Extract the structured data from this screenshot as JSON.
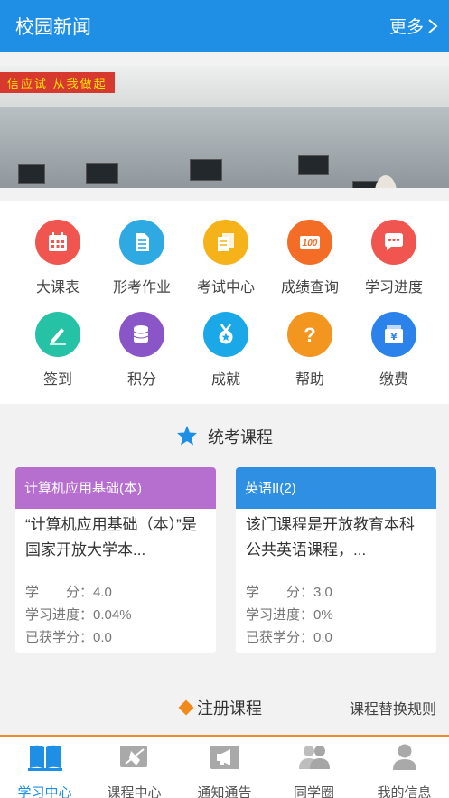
{
  "header": {
    "title": "校园新闻",
    "more_label": "更多"
  },
  "banner": {
    "slogan": "信应试  从我做起"
  },
  "grid": {
    "items": [
      {
        "label": "大课表",
        "icon": "calendar-icon",
        "color": "#f0554f"
      },
      {
        "label": "形考作业",
        "icon": "document-icon",
        "color": "#2ea9e2"
      },
      {
        "label": "考试中心",
        "icon": "copy-icon",
        "color": "#f5b319"
      },
      {
        "label": "成绩查询",
        "icon": "score-100-icon",
        "color": "#f36d26"
      },
      {
        "label": "学习进度",
        "icon": "chat-bubble-icon",
        "color": "#f0554f"
      },
      {
        "label": "签到",
        "icon": "pencil-icon",
        "color": "#25c2a6"
      },
      {
        "label": "积分",
        "icon": "coins-icon",
        "color": "#8a55c7"
      },
      {
        "label": "成就",
        "icon": "medal-icon",
        "color": "#1aa8e8"
      },
      {
        "label": "帮助",
        "icon": "question-icon",
        "color": "#f3961f"
      },
      {
        "label": "缴费",
        "icon": "wallet-yen-icon",
        "color": "#2b82ea"
      }
    ]
  },
  "exam_courses": {
    "title": "统考课程",
    "cards": [
      {
        "band_label": "计算机应用基础(本)",
        "band_color": "#b66fcf",
        "desc": "“计算机应用基础（本）”是国家开放大学本...",
        "credit": "学　　分：4.0",
        "progress": "学习进度：0.04%",
        "earned": "已获学分：0.0"
      },
      {
        "band_label": "英语II(2)",
        "band_color": "#2f8fe2",
        "desc": "该门课程是开放教育本科公共英语课程，...",
        "credit": "学　　分：3.0",
        "progress": "学习进度：0%",
        "earned": "已获学分：0.0"
      }
    ]
  },
  "registered": {
    "title": "注册课程",
    "rules_link": "课程替换规则"
  },
  "tabbar": {
    "tabs": [
      {
        "label": "学习中心",
        "icon": "book-icon",
        "active": true
      },
      {
        "label": "课程中心",
        "icon": "course-icon",
        "active": false
      },
      {
        "label": "通知通告",
        "icon": "megaphone-icon",
        "active": false
      },
      {
        "label": "同学圈",
        "icon": "classmates-icon",
        "active": false
      },
      {
        "label": "我的信息",
        "icon": "user-icon",
        "active": false
      }
    ]
  },
  "colors": {
    "primary": "#1f8fe5",
    "accent": "#ee8b2a"
  }
}
